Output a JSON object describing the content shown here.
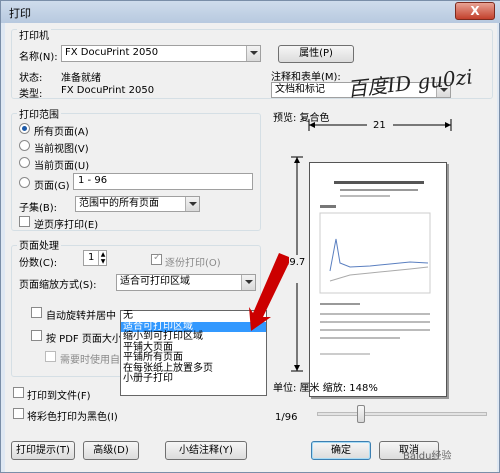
{
  "window": {
    "title": "打印",
    "close_glyph": "X"
  },
  "printer": {
    "group_label": "打印机",
    "name_label": "名称(N):",
    "name_value": "FX DocuPrint 2050",
    "properties_button": "属性(P)",
    "status_label": "状态:",
    "status_value": "准备就绪",
    "type_label": "类型:",
    "type_value": "FX DocuPrint 2050"
  },
  "comments": {
    "label": "注释和表单(M):",
    "value": "文档和标记"
  },
  "range": {
    "group_label": "打印范围",
    "all_pages": "所有页面(A)",
    "current_view": "当前视图(V)",
    "current_page": "当前页面(U)",
    "pages_label": "页面(G)",
    "pages_value": "1 - 96",
    "subset_label": "子集(B):",
    "subset_value": "范围中的所有页面",
    "reverse_pages": "逆页序打印(E)"
  },
  "handling": {
    "group_label": "页面处理",
    "copies_label": "份数(C):",
    "copies_value": "1",
    "collate": "逐份打印(O)",
    "scaling_label": "页面缩放方式(S):",
    "scaling_value": "适合可打印区域",
    "auto_rotate": "自动旋转并居中",
    "choose_paper": "按 PDF 页面大小",
    "custom_paper": "需要时使用自定"
  },
  "scaling_options": [
    "无",
    "适合可打印区域",
    "缩小到可打印区域",
    "平铺大页面",
    "平铺所有页面",
    "在每张纸上放置多页",
    "小册子打印"
  ],
  "print_to_file": "打印到文件(F)",
  "print_black": "将彩色打印为黑色(I)",
  "preview": {
    "label": "预览: 复合色",
    "width_value": "21",
    "height_value": "29.7",
    "units_text": "单位: 厘米 缩放: 148%",
    "page_text": "1/96"
  },
  "buttons": {
    "tips": "打印提示(T)",
    "advanced": "高级(D)",
    "summarize": "小结注释(Y)",
    "ok": "确定",
    "cancel": "取消"
  },
  "watermark": {
    "text": "百度ID gu0zi",
    "bottom": "Baidu经验"
  },
  "colors": {
    "accent": "#3399ff",
    "arrow": "#cc0000"
  }
}
